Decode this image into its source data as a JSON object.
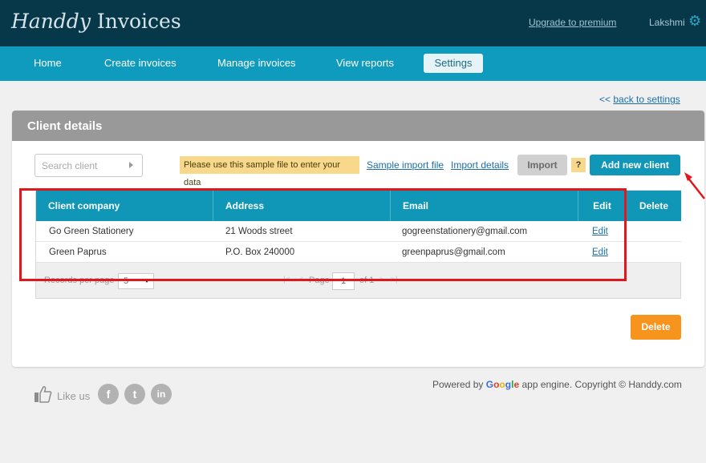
{
  "header": {
    "logo_part1": "Handdy",
    "logo_part2": "Invoices",
    "upgrade_link": "Upgrade to premium",
    "user_name": "Lakshmi",
    "settings_icon": "gear-icon"
  },
  "nav": {
    "items": [
      {
        "label": "Home"
      },
      {
        "label": "Create invoices"
      },
      {
        "label": "Manage invoices"
      },
      {
        "label": "View reports"
      },
      {
        "label": "Settings",
        "active": true
      }
    ]
  },
  "back_link": {
    "arrows": "<<",
    "label": "back to settings"
  },
  "panel": {
    "title": "Client details",
    "search_placeholder": "Search client",
    "notice": "Please use this sample file to enter your data",
    "sample_link": "Sample import file",
    "import_details_link": "Import details",
    "import_button": "Import",
    "help_label": "?",
    "add_button": "Add new client",
    "delete_button": "Delete"
  },
  "table": {
    "columns": [
      "Client company",
      "Address",
      "Email",
      "Edit",
      "Delete"
    ],
    "rows": [
      {
        "company": "Go Green Stationery",
        "address": "21 Woods street",
        "email": "gogreenstationery@gmail.com",
        "edit": "Edit"
      },
      {
        "company": "Green Paprus",
        "address": "P.O. Box 240000",
        "email": "greenpaprus@gmail.com",
        "edit": "Edit"
      }
    ],
    "pager": {
      "records_per_page_label": "Records per page",
      "records_per_page_value": "5",
      "first": "|<",
      "prev": "<",
      "page_label": "Page",
      "page_value": "1",
      "of_label": "of 1",
      "next": ">",
      "last": ">|"
    }
  },
  "footer": {
    "like_label": "Like us",
    "social": [
      {
        "name": "facebook",
        "glyph": "f"
      },
      {
        "name": "twitter",
        "glyph": "t"
      },
      {
        "name": "linkedin",
        "glyph": "in"
      }
    ],
    "powered_prefix": "Powered by",
    "google": [
      "G",
      "o",
      "o",
      "g",
      "l",
      "e"
    ],
    "powered_suffix": "app engine. Copyright © Handdy.com"
  },
  "colors": {
    "topbar": "#07384a",
    "nav": "#0f9bbd",
    "accent": "#1097b8",
    "delete_button": "#f7941d",
    "annotation": "#e0181e"
  }
}
